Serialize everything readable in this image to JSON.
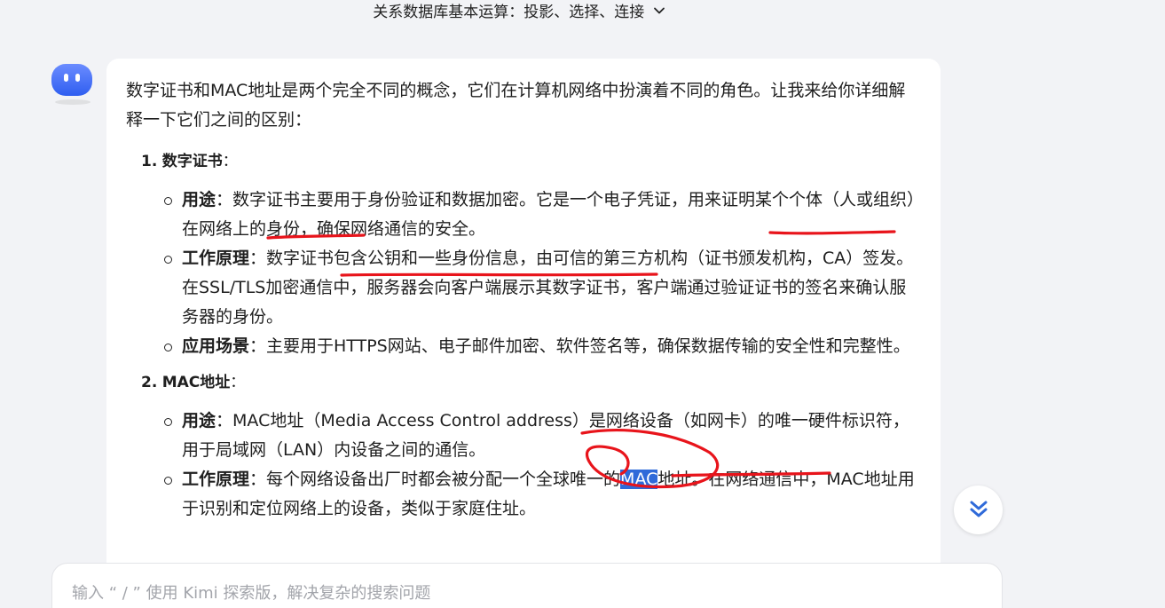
{
  "header": {
    "title": "关系数据库基本运算：投影、选择、连接",
    "chevron_icon": "chevron-down-icon"
  },
  "message": {
    "intro": "数字证书和MAC地址是两个完全不同的概念，它们在计算机网络中扮演着不同的角色。让我来给你详细解释一下它们之间的区别：",
    "sections": [
      {
        "number": "1.",
        "title": "数字证书",
        "colon": "：",
        "items": [
          {
            "key": "用途",
            "sep": "：",
            "text": "数字证书主要用于身份验证和数据加密。它是一个电子凭证，用来证明某个个体（人或组织）在网络上的身份，确保网络通信的安全。"
          },
          {
            "key": "工作原理",
            "sep": "：",
            "text": "数字证书包含公钥和一些身份信息，由可信的第三方机构（证书颁发机构，CA）签发。在SSL/TLS加密通信中，服务器会向客户端展示其数字证书，客户端通过验证证书的签名来确认服务器的身份。"
          },
          {
            "key": "应用场景",
            "sep": "：",
            "text": "主要用于HTTPS网站、电子邮件加密、软件签名等，确保数据传输的安全性和完整性。"
          }
        ]
      },
      {
        "number": "2.",
        "title": "MAC地址",
        "colon": "：",
        "items": [
          {
            "key": "用途",
            "sep": "：",
            "text": "MAC地址（Media Access Control address）是网络设备（如网卡）的唯一硬件标识符，用于局域网（LAN）内设备之间的通信。"
          },
          {
            "key": "工作原理",
            "sep": "：",
            "text_before": "每个网络设备出厂时都会被分配一个全球唯一的",
            "highlight": "MAC",
            "text_after": "地址。在网络通信中，MAC地址用于识别和定位网络上的设备，类似于家庭住址。"
          }
        ]
      }
    ]
  },
  "input": {
    "placeholder": "输入 “ / ” 使用 Kimi 探索版，解决复杂的搜索问题"
  },
  "colors": {
    "background": "#f2f3f6",
    "card": "#ffffff",
    "accent": "#2f6ad9",
    "annotation": "#e8141b",
    "avatar": "#3d6ff5"
  },
  "icons": {
    "avatar": "kimi-avatar-icon",
    "scroll_down": "double-chevron-down-icon"
  }
}
